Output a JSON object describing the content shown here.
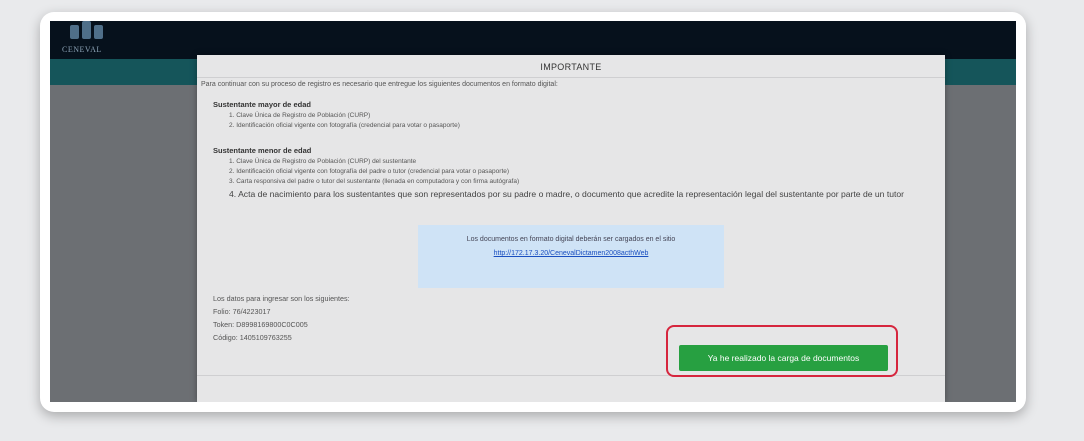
{
  "header": {
    "logo_text": "CENEVAL"
  },
  "modal": {
    "title": "IMPORTANTE",
    "intro": "Para continuar con su proceso de registro es necesario que entregue los siguientes documentos en formato digital:",
    "adult": {
      "title": "Sustentante mayor de edad",
      "items": [
        "1. Clave Única de Registro de Población (CURP)",
        "2. Identificación oficial vigente con fotografía (credencial para votar o pasaporte)"
      ]
    },
    "minor": {
      "title": "Sustentante menor de edad",
      "items": [
        "1. Clave Única de Registro de Población (CURP) del sustentante",
        "2. Identificación oficial vigente con fotografía del padre o tutor (credencial para votar o pasaporte)",
        "3. Carta responsiva del padre o tutor del sustentante (llenada en computadora y con firma autógrafa)",
        "4. Acta de nacimiento para los sustentantes que son representados por su padre o madre, o documento que acredite la representación legal del sustentante por parte de un tutor"
      ]
    },
    "info": {
      "text": "Los documentos en formato digital deberán ser cargados en el sitio",
      "link": "http://172.17.3.20/CenevalDictamen2008acthWeb"
    },
    "credentials": {
      "heading": "Los datos para ingresar son los siguientes:",
      "folio": "Folio: 76/4223017",
      "token": "Token: D8998169800C0C005",
      "codigo": "Código: 1405109763255"
    },
    "button_label": "Ya he realizado la carga de documentos"
  },
  "colors": {
    "topbar": "#06111c",
    "tealbar": "#15555a",
    "button": "#27a041",
    "highlight": "#d6263e",
    "info_box": "#cfe3f6"
  }
}
